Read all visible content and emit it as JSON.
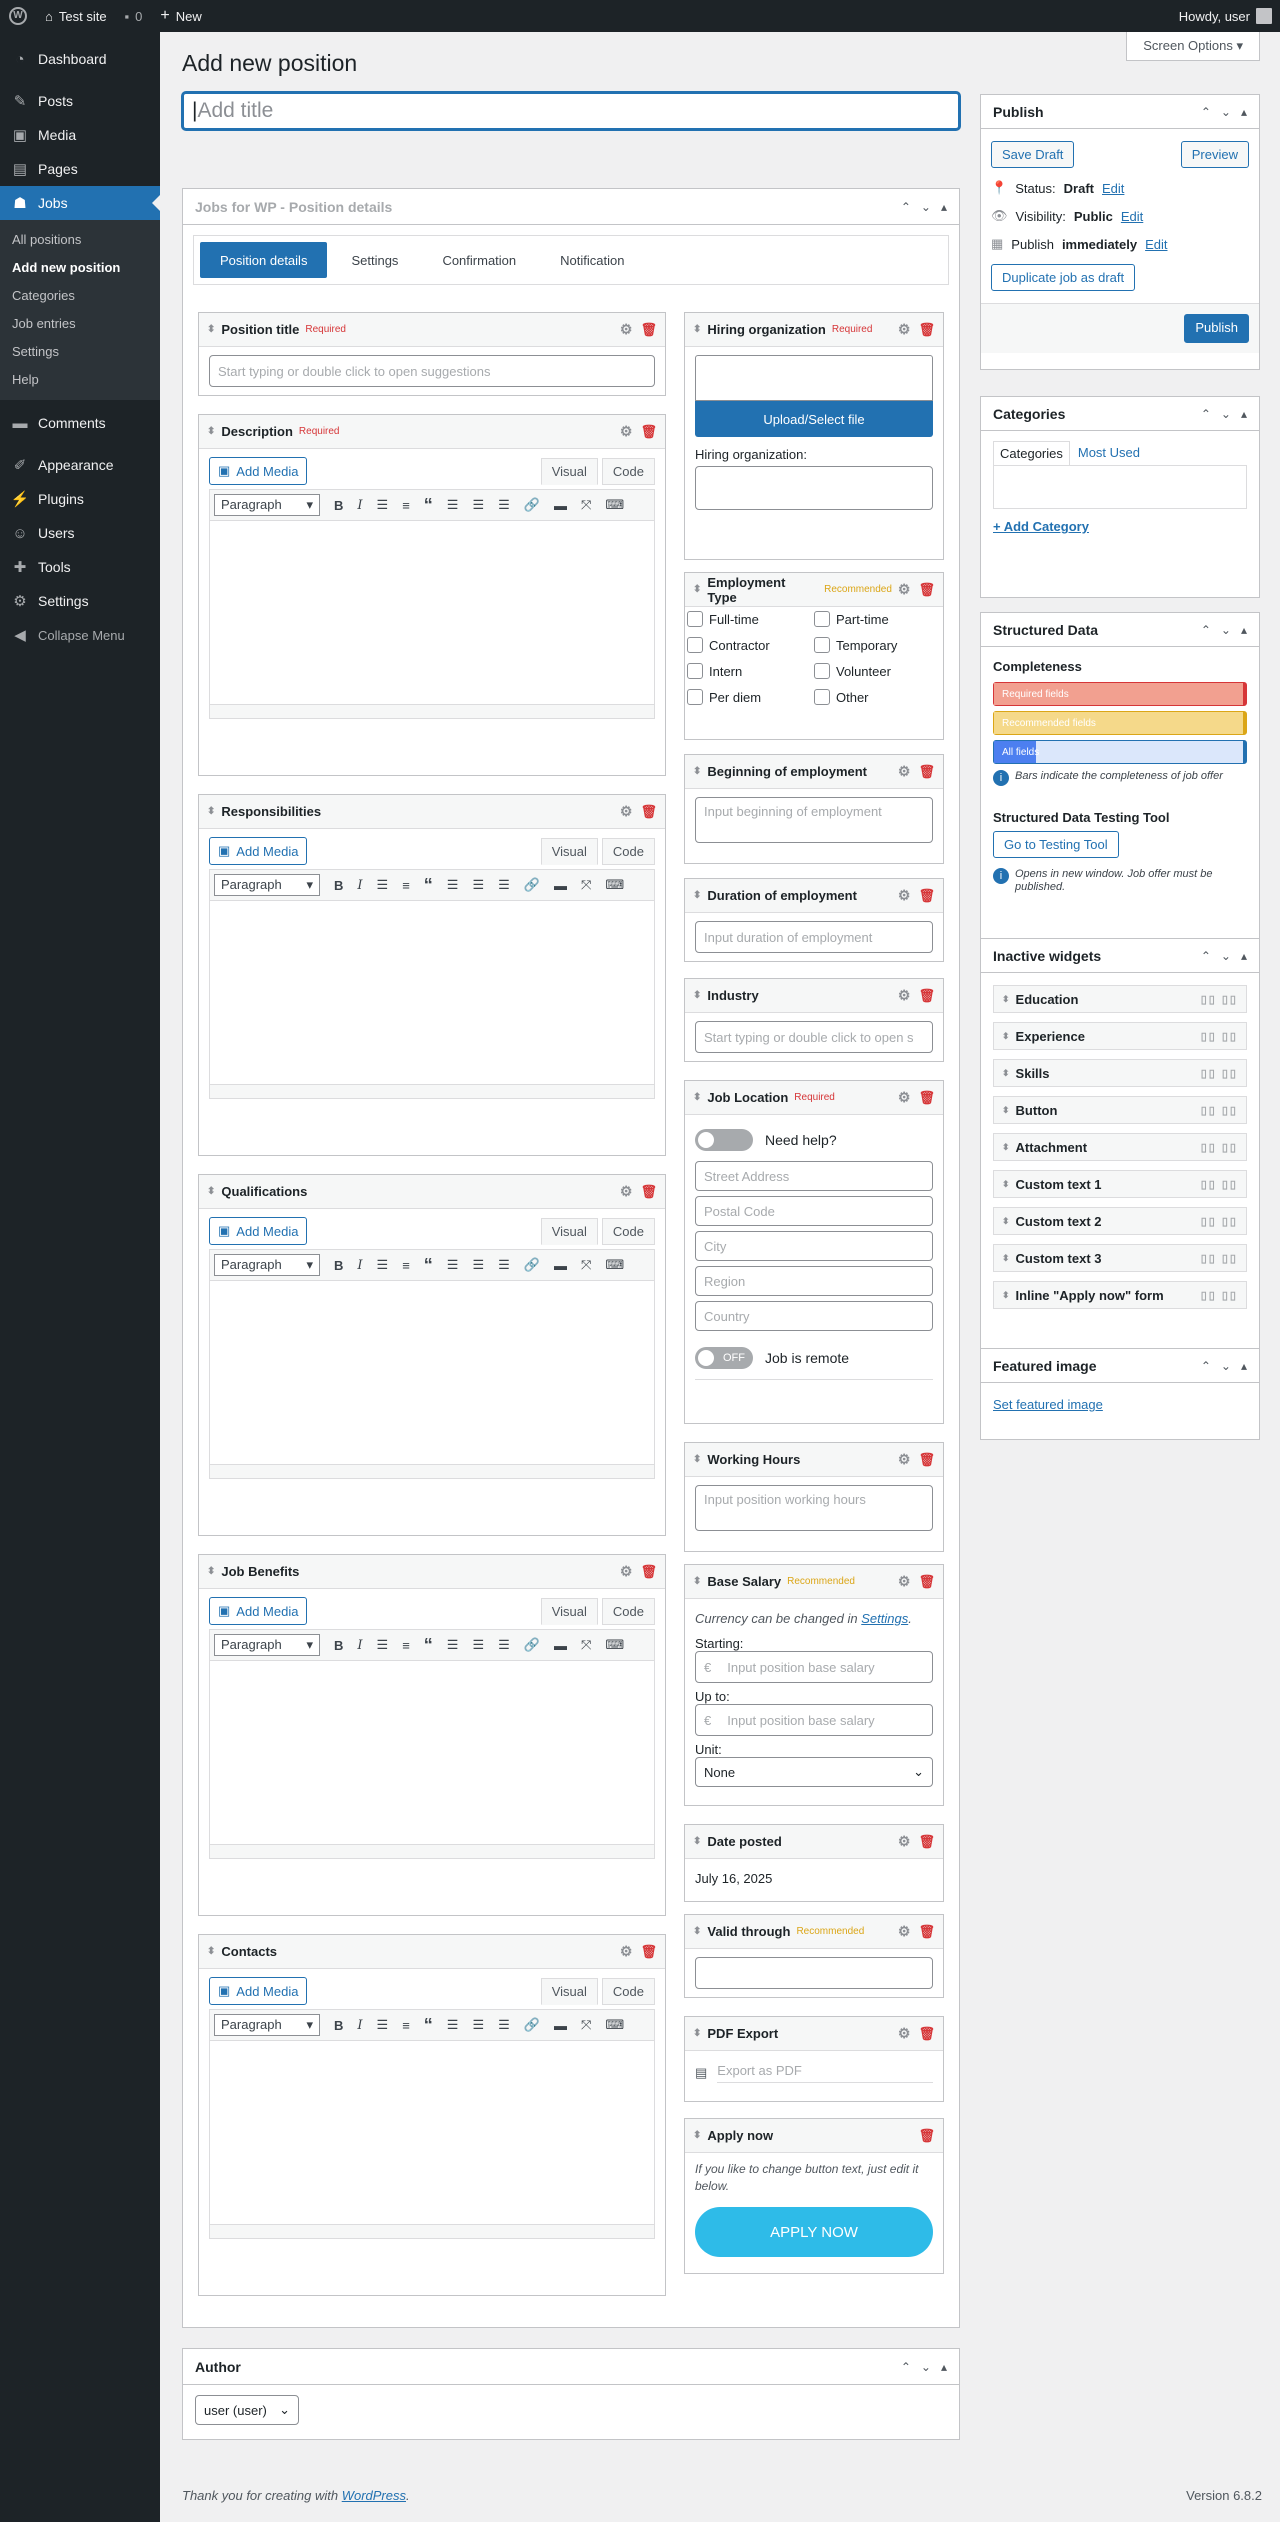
{
  "adminbar": {
    "site": "Test site",
    "comments": "0",
    "new": "New",
    "howdy": "Howdy, user"
  },
  "sidebar": {
    "items": [
      {
        "label": "Dashboard",
        "icon": "dashboard-icon"
      },
      {
        "label": "Posts",
        "icon": "pin-icon"
      },
      {
        "label": "Media",
        "icon": "media-icon"
      },
      {
        "label": "Pages",
        "icon": "pages-icon"
      },
      {
        "label": "Jobs",
        "icon": "jobs-icon"
      },
      {
        "label": "Comments",
        "icon": "comments-icon"
      },
      {
        "label": "Appearance",
        "icon": "brush-icon"
      },
      {
        "label": "Plugins",
        "icon": "plugin-icon"
      },
      {
        "label": "Users",
        "icon": "users-icon"
      },
      {
        "label": "Tools",
        "icon": "wrench-icon"
      },
      {
        "label": "Settings",
        "icon": "settings-icon"
      }
    ],
    "jobs_submenu": [
      "All positions",
      "Add new position",
      "Categories",
      "Job entries",
      "Settings",
      "Help"
    ],
    "collapse": "Collapse Menu"
  },
  "page": {
    "title": "Add new position",
    "screen_options": "Screen Options",
    "title_placeholder": "Add title"
  },
  "details": {
    "heading": "Jobs for WP - Position details",
    "tabs": [
      "Position details",
      "Settings",
      "Confirmation",
      "Notification"
    ]
  },
  "editor": {
    "add_media": "Add Media",
    "visual": "Visual",
    "code": "Code",
    "paragraph": "Paragraph"
  },
  "left_widgets": {
    "position_title": {
      "label": "Position title",
      "badge": "Required",
      "placeholder": "Start typing or double click to open suggestions"
    },
    "description": {
      "label": "Description",
      "badge": "Required"
    },
    "responsibilities": {
      "label": "Responsibilities"
    },
    "qualifications": {
      "label": "Qualifications"
    },
    "job_benefits": {
      "label": "Job Benefits"
    },
    "contacts": {
      "label": "Contacts"
    }
  },
  "right_widgets": {
    "hiring": {
      "label": "Hiring organization",
      "badge": "Required",
      "upload": "Upload/Select file",
      "org_label": "Hiring organization:"
    },
    "employment_type": {
      "label": "Employment Type",
      "badge": "Recommended",
      "options": [
        "Full-time",
        "Part-time",
        "Contractor",
        "Temporary",
        "Intern",
        "Volunteer",
        "Per diem",
        "Other"
      ]
    },
    "beginning": {
      "label": "Beginning of employment",
      "placeholder": "Input beginning of employment"
    },
    "duration": {
      "label": "Duration of employment",
      "placeholder": "Input duration of employment"
    },
    "industry": {
      "label": "Industry",
      "placeholder": "Start typing or double click to open s"
    },
    "location": {
      "label": "Job Location",
      "badge": "Required",
      "need_help": "Need help?",
      "fields": [
        "Street Address",
        "Postal Code",
        "City",
        "Region",
        "Country"
      ],
      "off": "OFF",
      "remote": "Job is remote"
    },
    "hours": {
      "label": "Working Hours",
      "placeholder": "Input position working hours"
    },
    "salary": {
      "label": "Base Salary",
      "badge": "Recommended",
      "note": "Currency can be changed in",
      "note_link": "Settings",
      "starting": "Starting:",
      "upto": "Up to:",
      "currency": "€",
      "placeholder": "Input position base salary",
      "unit": "Unit:",
      "unit_value": "None"
    },
    "date_posted": {
      "label": "Date posted",
      "value": "July 16, 2025"
    },
    "valid": {
      "label": "Valid through",
      "badge": "Recommended"
    },
    "pdf": {
      "label": "PDF Export",
      "placeholder": "Export as PDF"
    },
    "apply": {
      "label": "Apply now",
      "note": "If you like to change button text, just edit it below.",
      "button": "APPLY NOW"
    }
  },
  "publish": {
    "title": "Publish",
    "save_draft": "Save Draft",
    "preview": "Preview",
    "status_label": "Status:",
    "status_value": "Draft",
    "visibility_label": "Visibility:",
    "visibility_value": "Public",
    "publish_label": "Publish",
    "publish_value": "immediately",
    "edit": "Edit",
    "duplicate": "Duplicate job as draft",
    "publish_btn": "Publish"
  },
  "categories": {
    "title": "Categories",
    "tab_all": "Categories",
    "tab_used": "Most Used",
    "add": "+ Add Category"
  },
  "structured": {
    "title": "Structured Data",
    "completeness": "Completeness",
    "bars": [
      {
        "label": "Required fields",
        "fill": 1.0,
        "color": "#f2a090",
        "edge": "#d63638"
      },
      {
        "label": "Recommended fields",
        "fill": 1.0,
        "color": "#f5d98a",
        "edge": "#dba617"
      },
      {
        "label": "All fields",
        "fill": 0.17,
        "color": "#4c7ff0",
        "edge": "#2271b1"
      }
    ],
    "bars_info": "Bars indicate the completeness of job offer",
    "testing_title": "Structured Data Testing Tool",
    "testing_btn": "Go to Testing Tool",
    "testing_info": "Opens in new window. Job offer must be published."
  },
  "inactive": {
    "title": "Inactive widgets",
    "items": [
      "Education",
      "Experience",
      "Skills",
      "Button",
      "Attachment",
      "Custom text 1",
      "Custom text 2",
      "Custom text 3",
      "Inline \"Apply now\" form"
    ]
  },
  "featured": {
    "title": "Featured image",
    "link": "Set featured image"
  },
  "author": {
    "title": "Author",
    "value": "user (user)"
  },
  "footer": {
    "thanks": "Thank you for creating with",
    "link": "WordPress",
    "version": "Version 6.8.2"
  }
}
